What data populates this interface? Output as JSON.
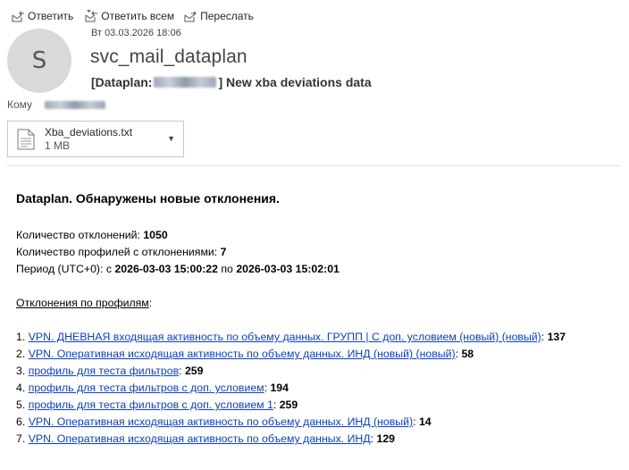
{
  "toolbar": {
    "reply_label": "Ответить",
    "reply_all_label": "Ответить всем",
    "forward_label": "Переслать"
  },
  "header": {
    "avatar_initial": "S",
    "date": "Вт 03.03.2026 18:06",
    "sender": "svc_mail_dataplan",
    "subject_prefix": "[Dataplan:",
    "subject_suffix": "] New xba deviations data",
    "to_label": "Кому"
  },
  "attachment": {
    "filename": "Xba_deviations.txt",
    "size": "1 MB"
  },
  "body": {
    "heading": "Dataplan. Обнаружены новые отклонения.",
    "count_label": "Количество отклонений: ",
    "count_value": "1050",
    "profiles_label": "Количество профилей с отклонениями: ",
    "profiles_value": "7",
    "period_label": "Период (UTC+0): с ",
    "period_from": "2026-03-03 15:00:22",
    "period_mid": " по ",
    "period_to": "2026-03-03 15:02:01",
    "by_profiles_label": "Отклонения по профилям",
    "colon": ":",
    "items": [
      {
        "num": "1. ",
        "name": "VPN. ДНЕВНАЯ входящая активность по объему данных. ГРУПП | С доп. условием (новый) (новый)",
        "sep": ": ",
        "value": "137"
      },
      {
        "num": "2. ",
        "name": "VPN. Оперативная исходящая активность по объему данных. ИНД (новый) (новый)",
        "sep": ": ",
        "value": "58"
      },
      {
        "num": "3. ",
        "name": "профиль для теста фильтров",
        "sep": ": ",
        "value": "259"
      },
      {
        "num": "4. ",
        "name": "профиль для теста фильтров с доп. условием",
        "sep": ": ",
        "value": "194"
      },
      {
        "num": "5. ",
        "name": "профиль для теста фильтров с доп. условием 1",
        "sep": ": ",
        "value": "259"
      },
      {
        "num": "6. ",
        "name": "VPN. Оперативная исходящая активность по объему данных. ИНД (новый)",
        "sep": ": ",
        "value": "14"
      },
      {
        "num": "7. ",
        "name": "VPN. Оперативная исходящая активность по объему данных. ИНД",
        "sep": ": ",
        "value": "129"
      }
    ]
  }
}
